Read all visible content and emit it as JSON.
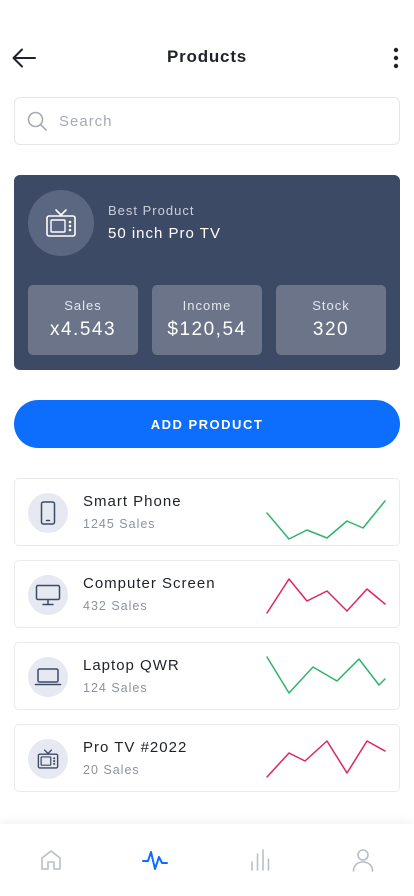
{
  "header": {
    "title": "Products"
  },
  "search": {
    "placeholder": "Search",
    "value": ""
  },
  "hero": {
    "kicker": "Best Product",
    "name": "50 inch Pro TV",
    "stats": [
      {
        "label": "Sales",
        "value": "x4.543"
      },
      {
        "label": "Income",
        "value": "$120,54"
      },
      {
        "label": "Stock",
        "value": "320"
      }
    ]
  },
  "add_button": {
    "label": "ADD PRODUCT"
  },
  "products": [
    {
      "name": "Smart Phone",
      "sales": "1245 Sales",
      "icon": "smartphone-icon",
      "trend": "up",
      "trend_color": "#2fb36b"
    },
    {
      "name": "Computer Screen",
      "sales": "432 Sales",
      "icon": "monitor-icon",
      "trend": "down",
      "trend_color": "#e0245e"
    },
    {
      "name": "Laptop QWR",
      "sales": "124 Sales",
      "icon": "laptop-icon",
      "trend": "up",
      "trend_color": "#2fb36b"
    },
    {
      "name": "Pro TV #2022",
      "sales": "20 Sales",
      "icon": "tv-icon",
      "trend": "down",
      "trend_color": "#e0245e"
    }
  ],
  "nav": {
    "items": [
      {
        "icon": "home-icon",
        "active": false
      },
      {
        "icon": "activity-icon",
        "active": true
      },
      {
        "icon": "bar-chart-icon",
        "active": false
      },
      {
        "icon": "user-icon",
        "active": false
      }
    ],
    "active_color": "#0d6efd",
    "inactive_color": "#b9bec7"
  },
  "colors": {
    "accent": "#0d6efd",
    "hero_bg": "#3d4a66",
    "positive": "#2fb36b",
    "negative": "#e0245e"
  }
}
